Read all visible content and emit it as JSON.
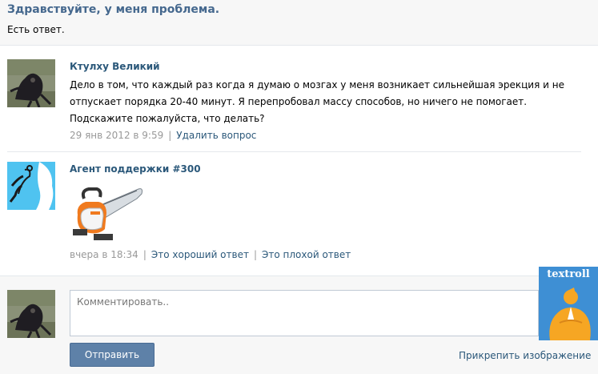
{
  "question": {
    "title": "Здравствуйте, у меня проблема.",
    "status": "Есть ответ."
  },
  "post": {
    "author": "Ктулху Великий",
    "text": "Дело в том, что каждый раз когда я думаю о мозгах у меня возникает сильнейшая эрекция и не отпускает порядка 20-40 минут. Я перепробовал массу способов, но ничего не помогает. Подскажите пожалуйста, что делать?",
    "date": "29 янв 2012 в 9:59",
    "delete_label": "Удалить вопрос"
  },
  "answer": {
    "author": "Агент поддержки #300",
    "attachment_icon": "chainsaw-icon",
    "date": "вчера в 18:34",
    "good_label": "Это хороший ответ",
    "bad_label": "Это плохой ответ"
  },
  "comment": {
    "placeholder": "Комментировать..",
    "send_label": "Отправить",
    "attach_label": "Прикрепить изображение"
  },
  "watermark": {
    "text": "textroll"
  },
  "colors": {
    "link": "#2b587a",
    "title": "#45688e",
    "button": "#5e81a8",
    "muted": "#999999"
  }
}
